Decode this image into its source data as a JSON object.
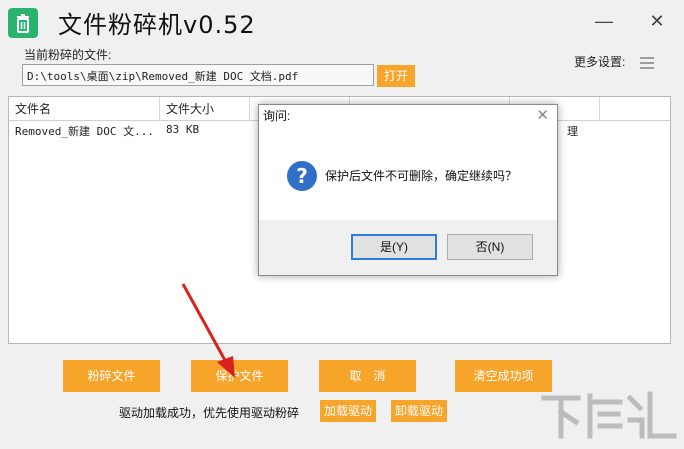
{
  "app": {
    "title": "文件粉碎机v0.52",
    "minimize_glyph": "—",
    "close_glyph": "✕"
  },
  "file_section": {
    "label": "当前粉碎的文件:",
    "path_value": "D:\\tools\\桌面\\zip\\Removed_新建 DOC 文档.pdf",
    "open_label": "打开",
    "more_settings_label": "更多设置:"
  },
  "table": {
    "columns": [
      "文件名",
      "文件大小",
      "",
      "",
      "",
      ""
    ],
    "rows": [
      {
        "name": "Removed_新建 DOC 文...",
        "size": "83  KB",
        "status_fragment": "理"
      }
    ]
  },
  "buttons": {
    "shred": "粉碎文件",
    "protect": "保护文件",
    "cancel": "取　消",
    "clear_success": "清空成功项",
    "load_driver": "加载驱动",
    "unload_driver": "卸载驱动"
  },
  "status": {
    "driver_message": "驱动加载成功，优先使用驱动粉碎"
  },
  "dialog": {
    "title": "询问:",
    "message": "保护后文件不可删除，确定继续吗？",
    "icon_glyph": "?",
    "yes_label": "是(Y)",
    "no_label": "否(N)",
    "close_glyph": "✕"
  },
  "colors": {
    "accent_orange": "#f7a42b",
    "app_icon_green": "#2ab36e",
    "dialog_icon_blue": "#2f6fc7",
    "arrow_red": "#d9221c"
  }
}
